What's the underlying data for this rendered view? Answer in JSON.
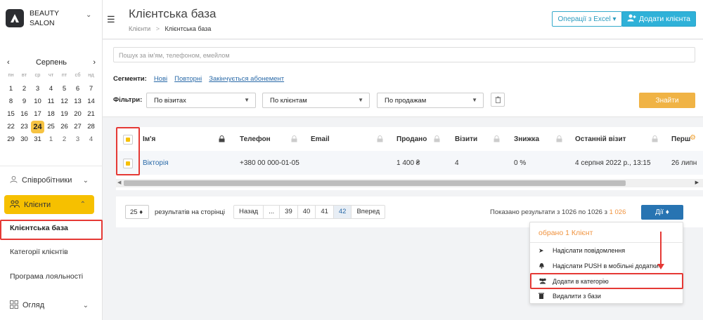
{
  "brand": {
    "line1": "BEAUTY",
    "line2": "SALON"
  },
  "calendar": {
    "month": "Серпень",
    "prev": "‹",
    "next": "›",
    "weekdays": [
      "пн",
      "вт",
      "ср",
      "чт",
      "пт",
      "сб",
      "нд"
    ],
    "weeks": [
      [
        "1",
        "2",
        "3",
        "4",
        "5",
        "6",
        "7"
      ],
      [
        "8",
        "9",
        "10",
        "11",
        "12",
        "13",
        "14"
      ],
      [
        "15",
        "16",
        "17",
        "18",
        "19",
        "20",
        "21"
      ],
      [
        "22",
        "23",
        "24",
        "25",
        "26",
        "27",
        "28"
      ],
      [
        "29",
        "30",
        "31",
        "1",
        "2",
        "3",
        "4"
      ]
    ],
    "today": "24"
  },
  "sidebar": {
    "staff": "Співробітники",
    "clients": "Клієнти",
    "client_base": "Клієнтська база",
    "client_categories": "Категорії клієнтів",
    "loyalty": "Програма лояльності",
    "overview": "Огляд"
  },
  "header": {
    "title": "Клієнтська база",
    "breadcrumb_root": "Клієнти",
    "breadcrumb_sep": ">",
    "breadcrumb_current": "Клієнтська база",
    "excel_btn": "Операції з Excel ▾",
    "add_btn": "Додати клієнта"
  },
  "filters": {
    "search_placeholder": "Пошук за ім'ям, телефоном, емейлом",
    "segments_label": "Сегменти:",
    "segments": [
      "Нові",
      "Повторні",
      "Закінчується абонемент"
    ],
    "filters_label": "Фільтри:",
    "by_visits": "По візитах",
    "by_clients": "По клієнтам",
    "by_sales": "По продажам",
    "find_btn": "Знайти"
  },
  "table": {
    "headers": {
      "name": "Ім'я",
      "phone": "Телефон",
      "email": "Email",
      "sold": "Продано",
      "visits": "Візити",
      "discount": "Знижка",
      "last_visit": "Останній візит",
      "first": "Перш"
    },
    "row": {
      "name": "Вікторія",
      "phone": "+380 00 000-01-05",
      "email": "",
      "sold": "1 400 ₴",
      "visits": "4",
      "discount": "0 %",
      "last_visit": "4 серпня 2022 р., 13:15",
      "first": "26 липн"
    }
  },
  "pagination": {
    "per_page": "25 ♦",
    "per_page_label": "результатів на сторінці",
    "prev": "Назад",
    "ellipsis": "...",
    "pages": [
      "39",
      "40",
      "41",
      "42"
    ],
    "current": "42",
    "next": "Вперед",
    "shown_text": "Показано результати з 1026 по 1026 з",
    "total": "1 026",
    "actions_btn": "Дії ♦"
  },
  "actions_menu": {
    "header": "обрано 1 Клієнт",
    "items": [
      {
        "label": "Надіслати повідомлення",
        "icon": "send-icon"
      },
      {
        "label": "Надіслати PUSH в мобільні додатки",
        "icon": "bell-icon"
      },
      {
        "label": "Додати в категорію",
        "icon": "users-icon"
      },
      {
        "label": "Видалити з бази",
        "icon": "trash-icon"
      }
    ]
  },
  "colors": {
    "accent_yellow": "#f6c000",
    "primary_blue": "#2874b2",
    "cyan": "#2fb1d8",
    "highlight_red": "#e53935",
    "orange": "#f0923d"
  }
}
